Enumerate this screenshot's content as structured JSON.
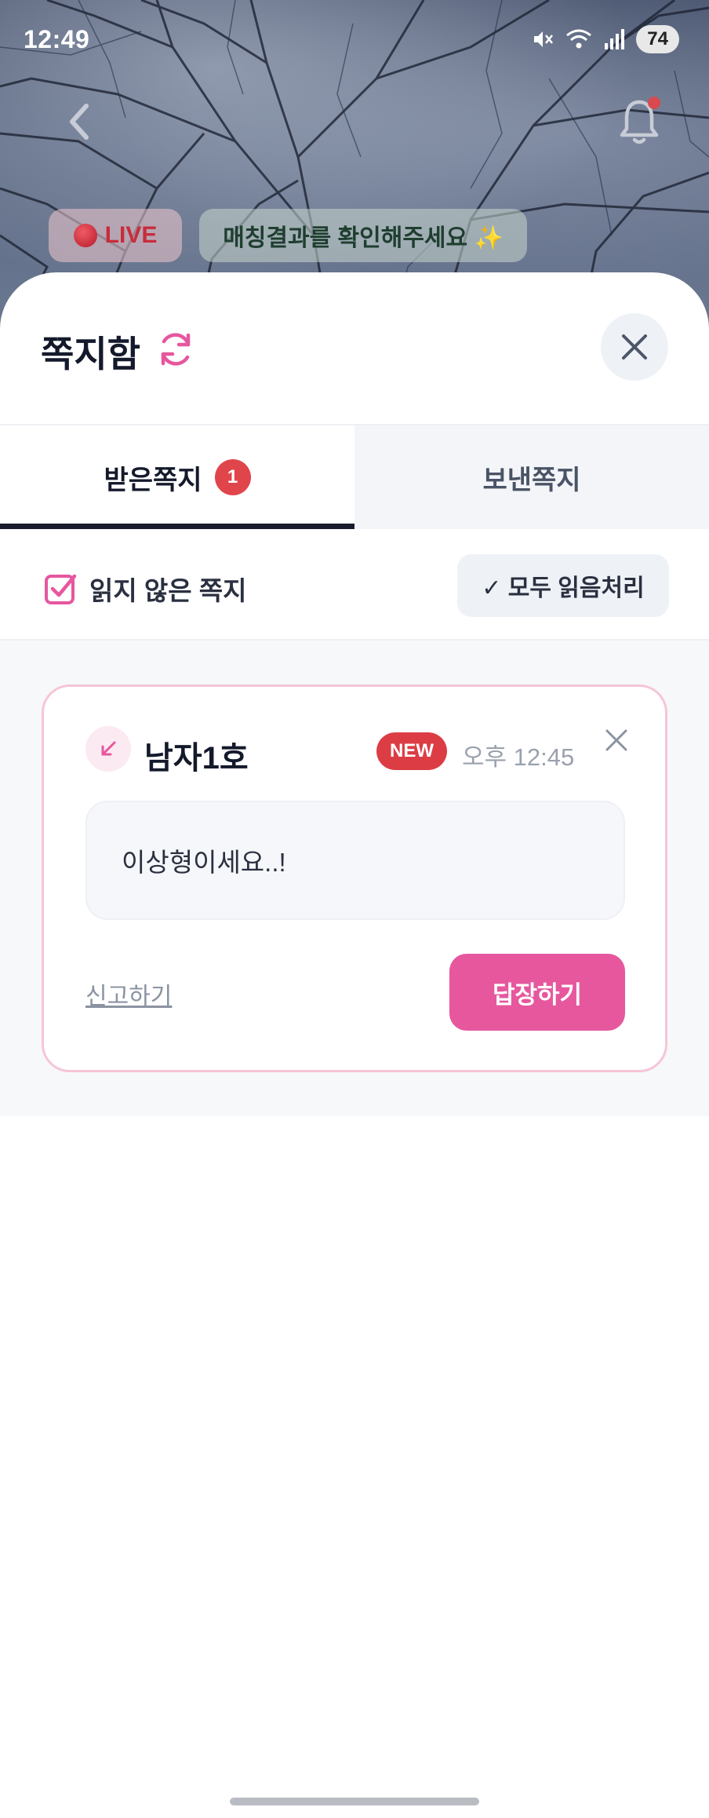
{
  "status_bar": {
    "time": "12:49",
    "battery": "74",
    "icons": [
      "mute-icon",
      "wifi-icon",
      "signal-icon",
      "battery-icon"
    ]
  },
  "top_bar": {
    "back_icon": "chevron-left-icon",
    "bell_icon": "bell-icon",
    "live_label": "LIVE",
    "notice_label": "매칭결과를 확인해주세요 ✨"
  },
  "sheet": {
    "title": "쪽지함",
    "refresh_icon": "refresh-icon",
    "close_icon": "close-icon"
  },
  "tabs": [
    {
      "label": "받은쪽지",
      "badge": "1",
      "active": true
    },
    {
      "label": "보낸쪽지",
      "active": false
    }
  ],
  "filter": {
    "unread_label": "읽지 않은 쪽지",
    "checked": true,
    "mark_all_label": "✓ 모두 읽음처리"
  },
  "messages": [
    {
      "direction_icon": "incoming-arrow-icon",
      "sender": "남자1호",
      "badge": "NEW",
      "time": "오후 12:45",
      "body": "이상형이세요..!",
      "report_label": "신고하기",
      "reply_label": "답장하기"
    }
  ],
  "colors": {
    "accent_pink": "#e6579e",
    "badge_red": "#dc3d45",
    "card_border": "#f6c5d8",
    "tab_underline": "#181c2c"
  }
}
